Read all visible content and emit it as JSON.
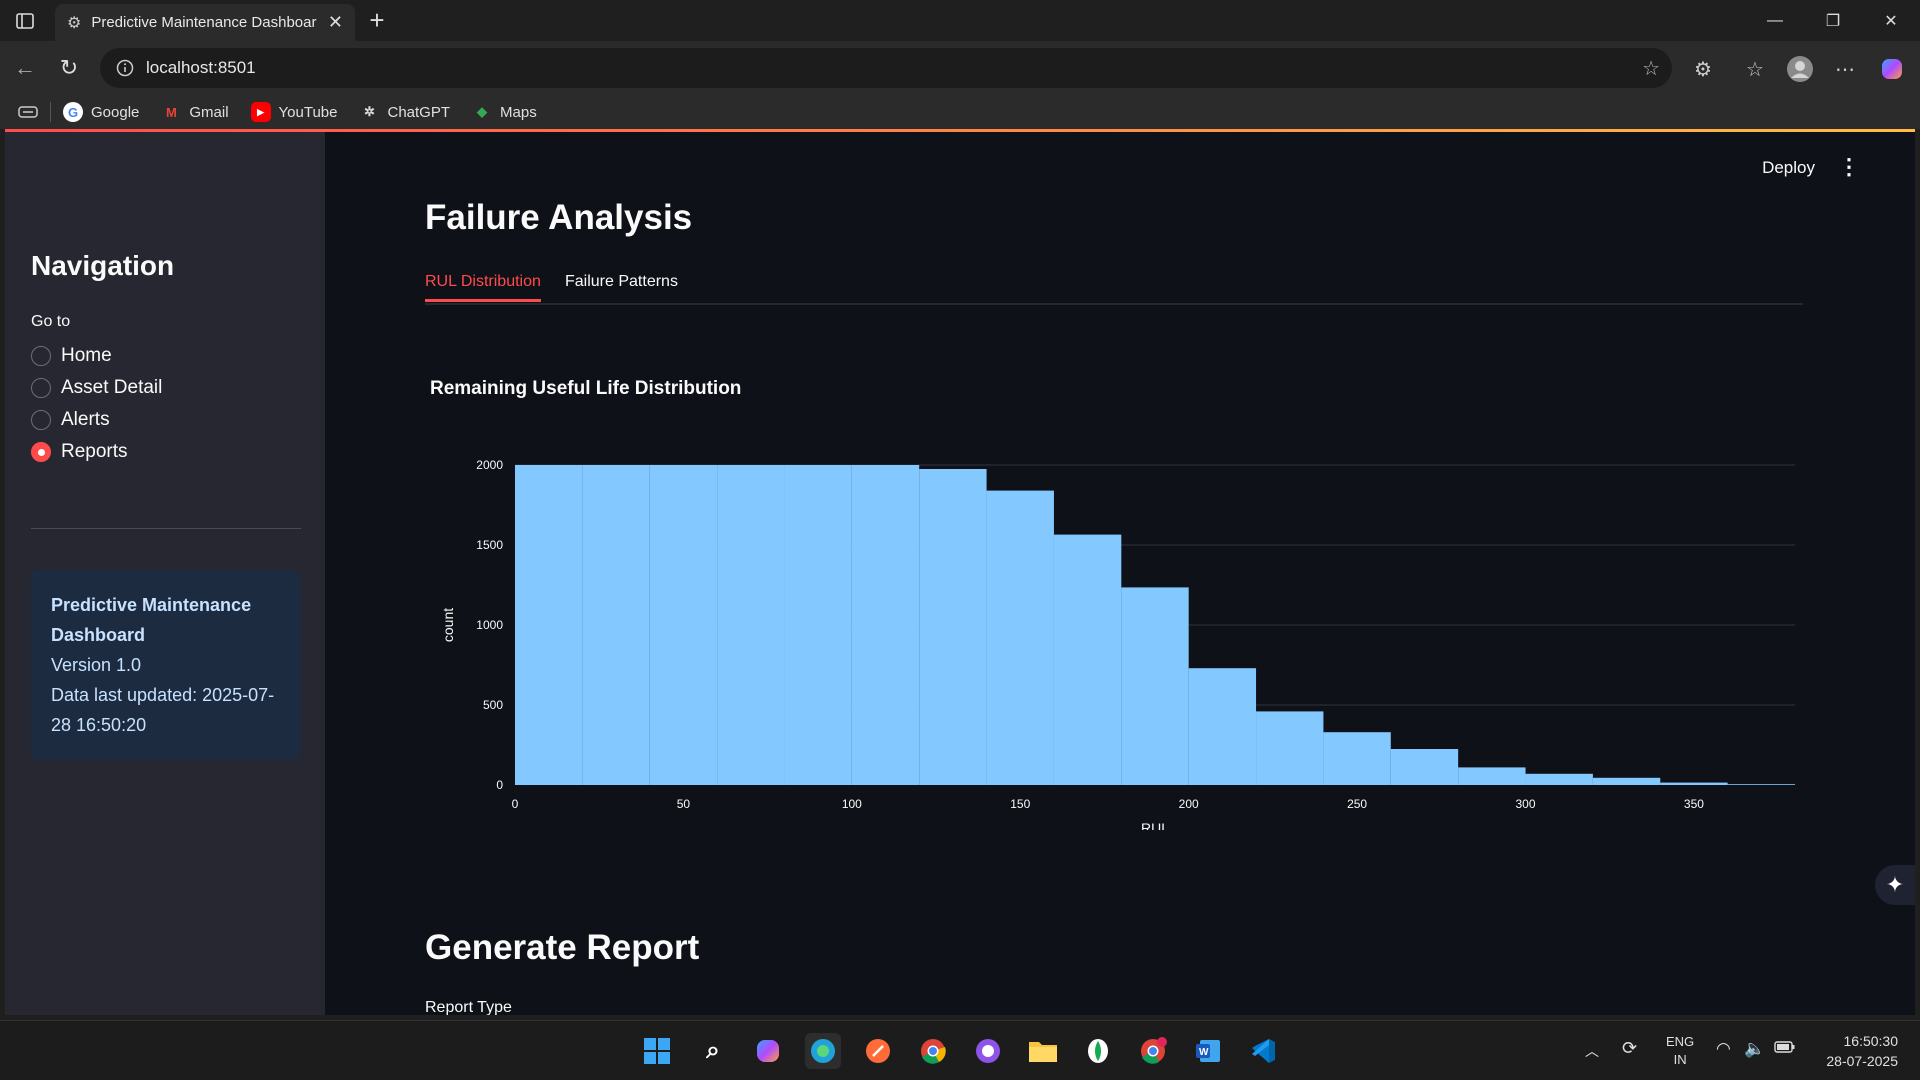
{
  "browser": {
    "tab_title": "Predictive Maintenance Dashboar",
    "url": "localhost:8501",
    "bookmarks": [
      {
        "label": "Google",
        "icon": "google-icon"
      },
      {
        "label": "Gmail",
        "icon": "gmail-icon"
      },
      {
        "label": "YouTube",
        "icon": "youtube-icon"
      },
      {
        "label": "ChatGPT",
        "icon": "chatgpt-icon"
      },
      {
        "label": "Maps",
        "icon": "maps-icon"
      }
    ]
  },
  "sidebar": {
    "title": "Navigation",
    "goto_label": "Go to",
    "options": [
      {
        "label": "Home",
        "selected": false
      },
      {
        "label": "Asset Detail",
        "selected": false
      },
      {
        "label": "Alerts",
        "selected": false
      },
      {
        "label": "Reports",
        "selected": true
      }
    ],
    "info": {
      "title": "Predictive Maintenance Dashboard",
      "version": "Version 1.0",
      "updated": "Data last updated: 2025-07-28 16:50:20"
    }
  },
  "header": {
    "deploy_label": "Deploy"
  },
  "main": {
    "title": "Failure Analysis",
    "tabs": [
      {
        "label": "RUL Distribution",
        "active": true
      },
      {
        "label": "Failure Patterns",
        "active": false
      }
    ],
    "section2_title": "Generate Report",
    "report_type_label": "Report Type"
  },
  "chart_data": {
    "type": "bar",
    "title": "Remaining Useful Life Distribution",
    "xlabel": "RUL",
    "ylabel": "count",
    "bin_width": 20,
    "x_bins": [
      0,
      20,
      40,
      60,
      80,
      100,
      120,
      140,
      160,
      180,
      200,
      220,
      240,
      260,
      280,
      300,
      320,
      340,
      360
    ],
    "values": [
      2000,
      2000,
      2000,
      2000,
      2000,
      2000,
      1975,
      1840,
      1565,
      1235,
      730,
      460,
      330,
      225,
      110,
      70,
      45,
      15,
      5
    ],
    "xlim": [
      0,
      380
    ],
    "ylim": [
      0,
      2000
    ],
    "xticks": [
      0,
      50,
      100,
      150,
      200,
      250,
      300,
      350
    ],
    "yticks": [
      0,
      500,
      1000,
      1500,
      2000
    ],
    "grid": true,
    "color": "#83c9ff"
  },
  "taskbar": {
    "language": "ENG",
    "region": "IN",
    "time": "16:50:30",
    "date": "28-07-2025"
  },
  "colors": {
    "accent": "#ff4b4b",
    "bar": "#83c9ff",
    "sidebar_bg": "#262730",
    "app_bg": "#0e1117",
    "info_bg": "#1c2b3f"
  }
}
